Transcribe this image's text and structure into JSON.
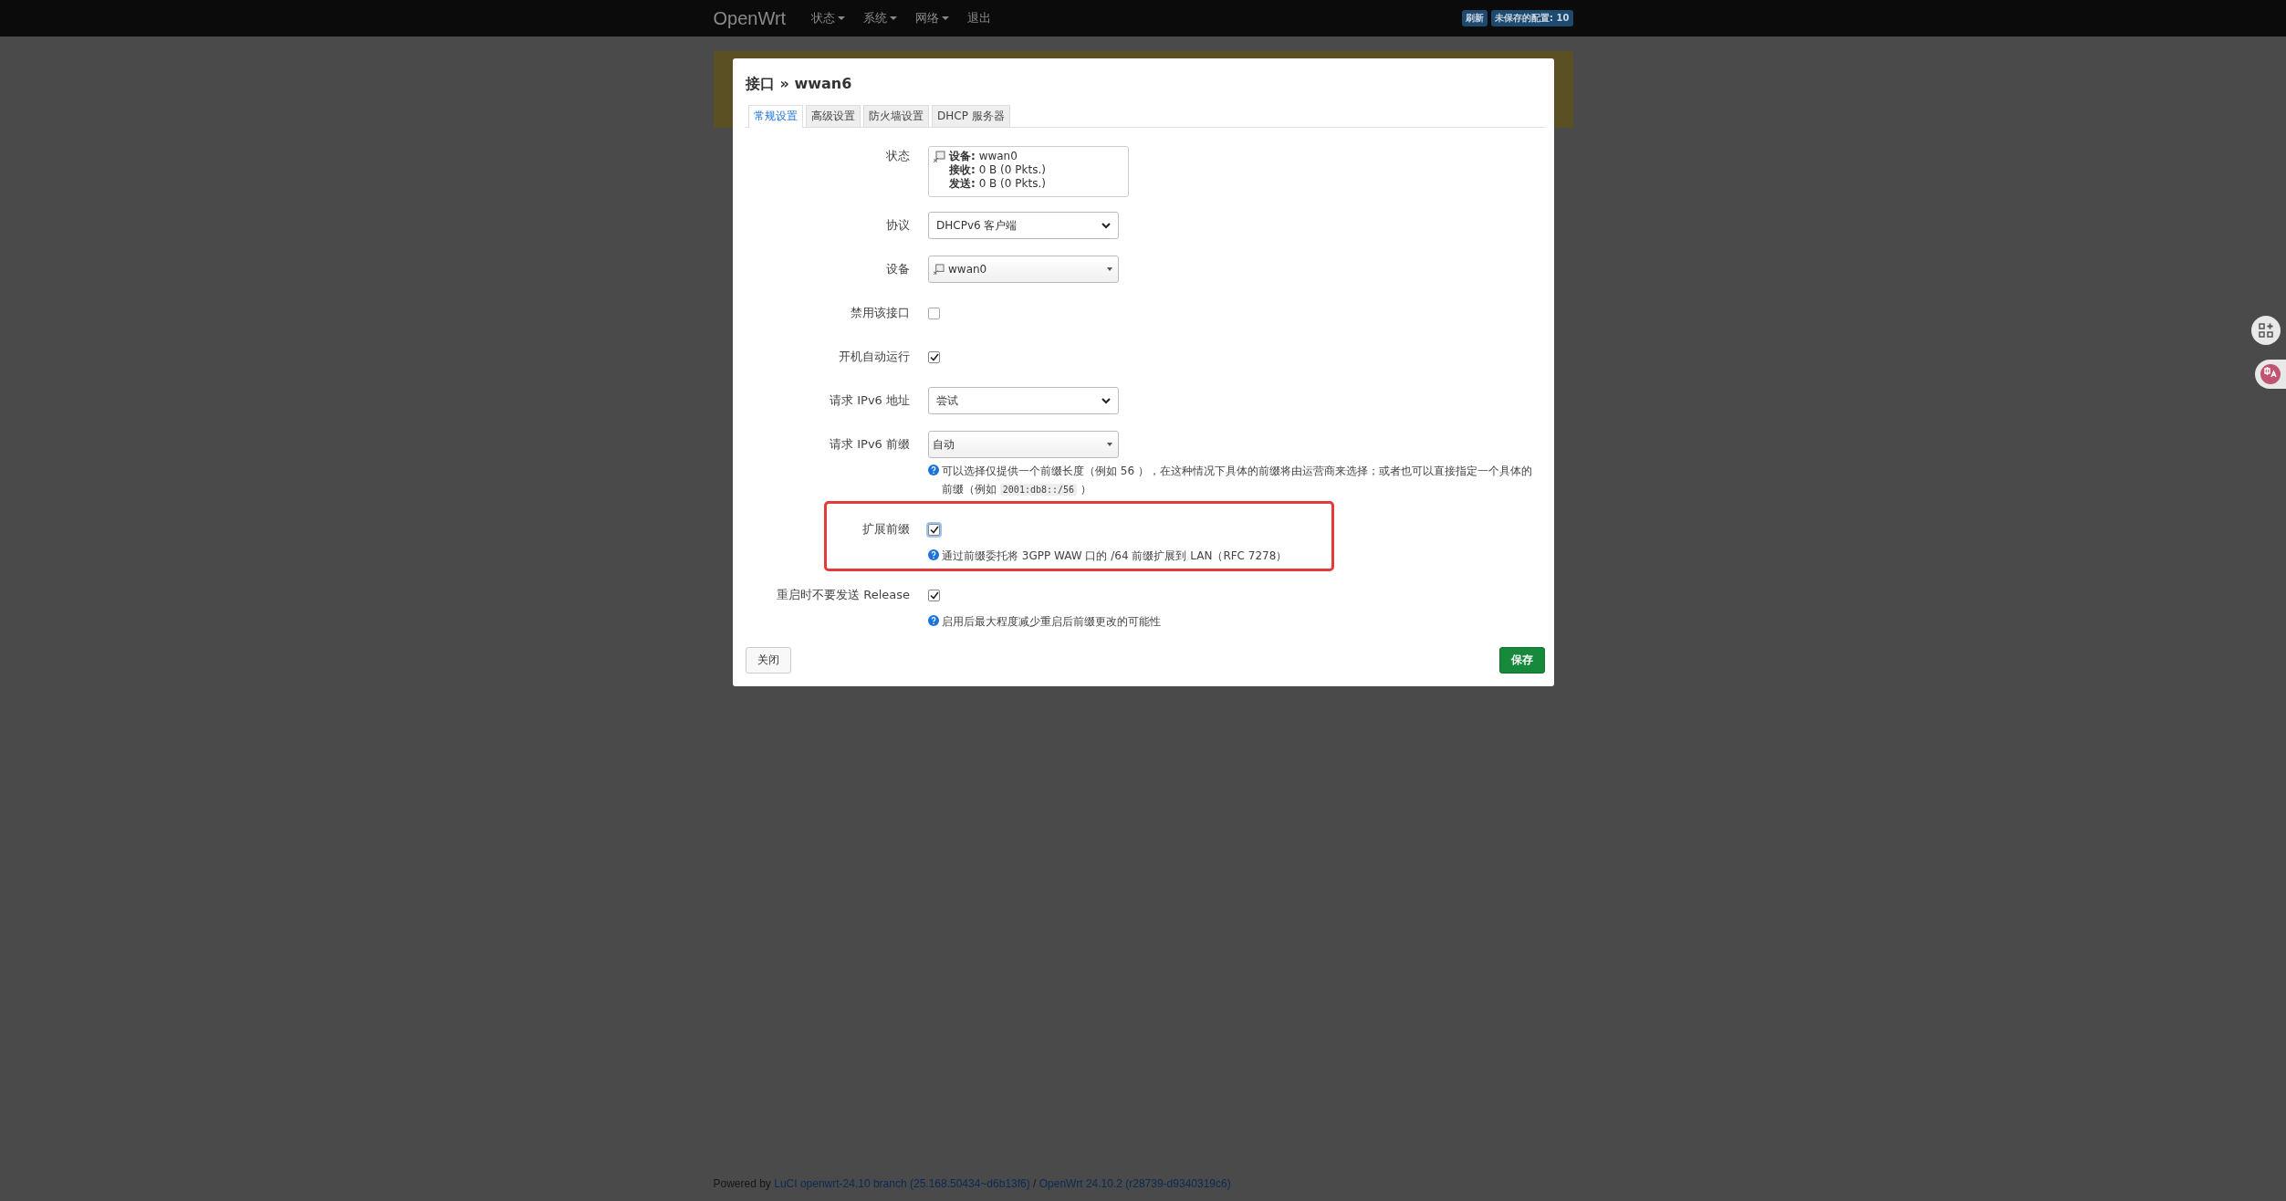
{
  "navbar": {
    "brand": "OpenWrt",
    "menus": [
      {
        "label": "状态",
        "dropdown": true
      },
      {
        "label": "系统",
        "dropdown": true
      },
      {
        "label": "网络",
        "dropdown": true
      },
      {
        "label": "退出",
        "dropdown": false
      }
    ],
    "badges": [
      "刷新",
      "未保存的配置: 10"
    ]
  },
  "modal": {
    "title": "接口 » wwan6",
    "tabs": [
      {
        "label": "常规设置",
        "selected": true
      },
      {
        "label": "高级设置",
        "selected": false
      },
      {
        "label": "防火墙设置",
        "selected": false
      },
      {
        "label": "DHCP 服务器",
        "selected": false
      }
    ],
    "fields": [
      {
        "kind": "status",
        "label": "状态",
        "lines": [
          "**设备:** wwan0",
          "**接收:** 0 B (0 Pkts.)",
          "**发送:** 0 B (0 Pkts.)"
        ]
      },
      {
        "kind": "select",
        "label": "协议",
        "value": "DHCPv6 客户端"
      },
      {
        "kind": "combo",
        "label": "设备",
        "value": "wwan0",
        "device_icon": true
      },
      {
        "kind": "checkbox",
        "label": "禁用该接口",
        "checked": false
      },
      {
        "kind": "checkbox",
        "label": "开机自动运行",
        "checked": true
      },
      {
        "kind": "select",
        "label": "请求 IPv6 地址",
        "value": "尝试"
      },
      {
        "kind": "combo",
        "label": "请求 IPv6 前缀",
        "value": "自动",
        "device_icon": false,
        "hint": [
          {
            "kind": "text",
            "text": "可以选择仅提供一个前缀长度（例如 56 ），在这种情况下具体的前缀将由运营商来选择；或者也可以直接指定一个具体的前缀（例如 "
          },
          {
            "kind": "code",
            "text": "2001:db8::/56"
          },
          {
            "kind": "text",
            "text": " ）"
          }
        ]
      },
      {
        "kind": "checkbox",
        "label": "扩展前缀",
        "checked": true,
        "highlighted": true,
        "focused": true,
        "hint": [
          {
            "kind": "text",
            "text": "通过前缀委托将 3GPP WAW 口的 /64 前缀扩展到 LAN（RFC 7278）"
          }
        ]
      },
      {
        "kind": "checkbox",
        "label": "重启时不要发送 Release",
        "checked": true,
        "hint": [
          {
            "kind": "text",
            "text": "启用后最大程度减少重启后前缀更改的可能性"
          }
        ]
      }
    ],
    "buttons": [
      {
        "label": "关闭",
        "kind": "default"
      },
      {
        "label": "保存",
        "kind": "primary"
      }
    ]
  },
  "footer": [
    {
      "text": "Powered by ",
      "link": false
    },
    {
      "text": "LuCI openwrt-24.10 branch (25.168.50434~d6b13f6)",
      "link": true
    },
    {
      "text": " / ",
      "link": false
    },
    {
      "text": "OpenWrt 24.10.2 (r28739-d9340319c6)",
      "link": true
    }
  ]
}
